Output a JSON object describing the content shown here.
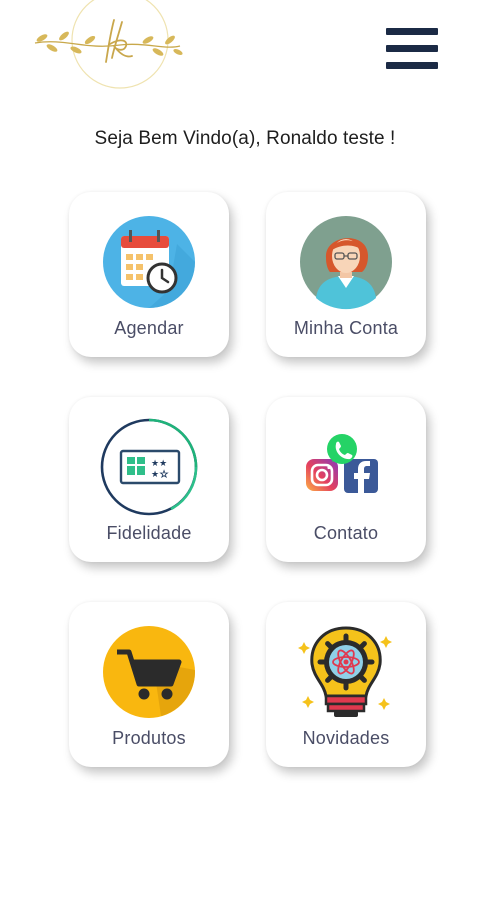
{
  "header": {
    "logo_icon": "gold-leaf-k-monogram-icon",
    "menu_icon": "hamburger-icon",
    "brand_color": "#1b2a45"
  },
  "welcome": {
    "text": "Seja Bem Vindo(a), Ronaldo teste !"
  },
  "tiles": [
    {
      "label": "Agendar",
      "icon": "calendar-clock-icon"
    },
    {
      "label": "Minha Conta",
      "icon": "user-avatar-icon"
    },
    {
      "label": "Fidelidade",
      "icon": "loyalty-card-icon"
    },
    {
      "label": "Contato",
      "icon": "social-media-icon"
    },
    {
      "label": "Produtos",
      "icon": "shopping-cart-icon"
    },
    {
      "label": "Novidades",
      "icon": "lightbulb-gear-icon"
    }
  ]
}
